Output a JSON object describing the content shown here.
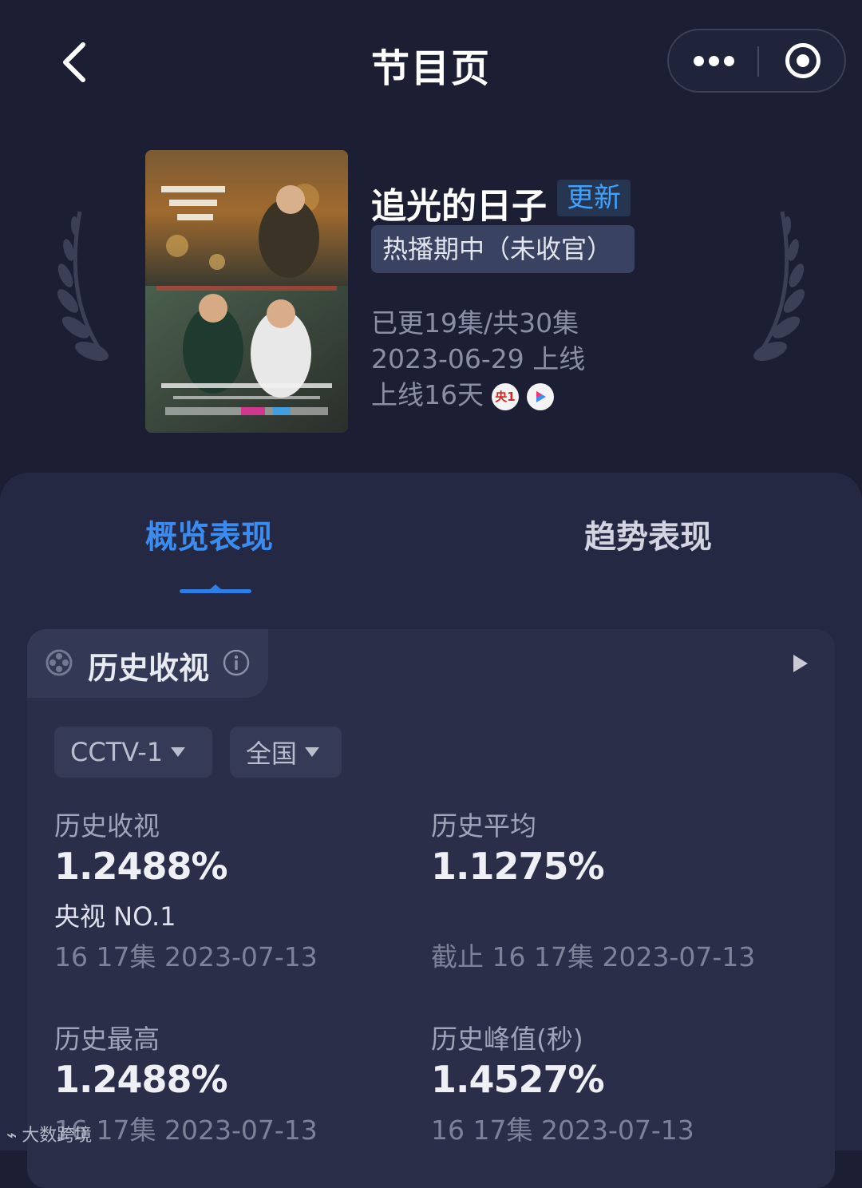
{
  "header": {
    "title": "节目页"
  },
  "show": {
    "title": "追光的日子",
    "update_badge": "更新",
    "status": "热播期中（未收官）",
    "episodes": "已更19集/共30集",
    "premiere": "2023-06-29 上线",
    "days_online": "上线16天",
    "channel_icons": [
      "cctv1-channel-icon",
      "youku-channel-icon"
    ],
    "cctv1_icon_text": "央1"
  },
  "tabs": [
    {
      "label": "概览表现",
      "active": true
    },
    {
      "label": "趋势表现",
      "active": false
    }
  ],
  "section": {
    "title": "历史收视",
    "filters": {
      "channel": "CCTV-1",
      "region": "全国"
    },
    "stats": {
      "history_rating": {
        "label": "历史收视",
        "value": "1.2488%",
        "rank": "央视 NO.1",
        "meta": "16 17集 2023-07-13"
      },
      "history_average": {
        "label": "历史平均",
        "value": "1.1275%",
        "meta": "截止 16 17集 2023-07-13"
      },
      "history_high": {
        "label": "历史最高",
        "value": "1.2488%",
        "meta": "16 17集 2023-07-13"
      },
      "history_peak": {
        "label": "历史峰值(秒)",
        "value": "1.4527%",
        "meta": "16 17集 2023-07-13"
      }
    }
  },
  "watermark": "大数跨境",
  "colors": {
    "accent": "#3a8cf0",
    "background": "#1c1f33",
    "panel": "#242842"
  }
}
